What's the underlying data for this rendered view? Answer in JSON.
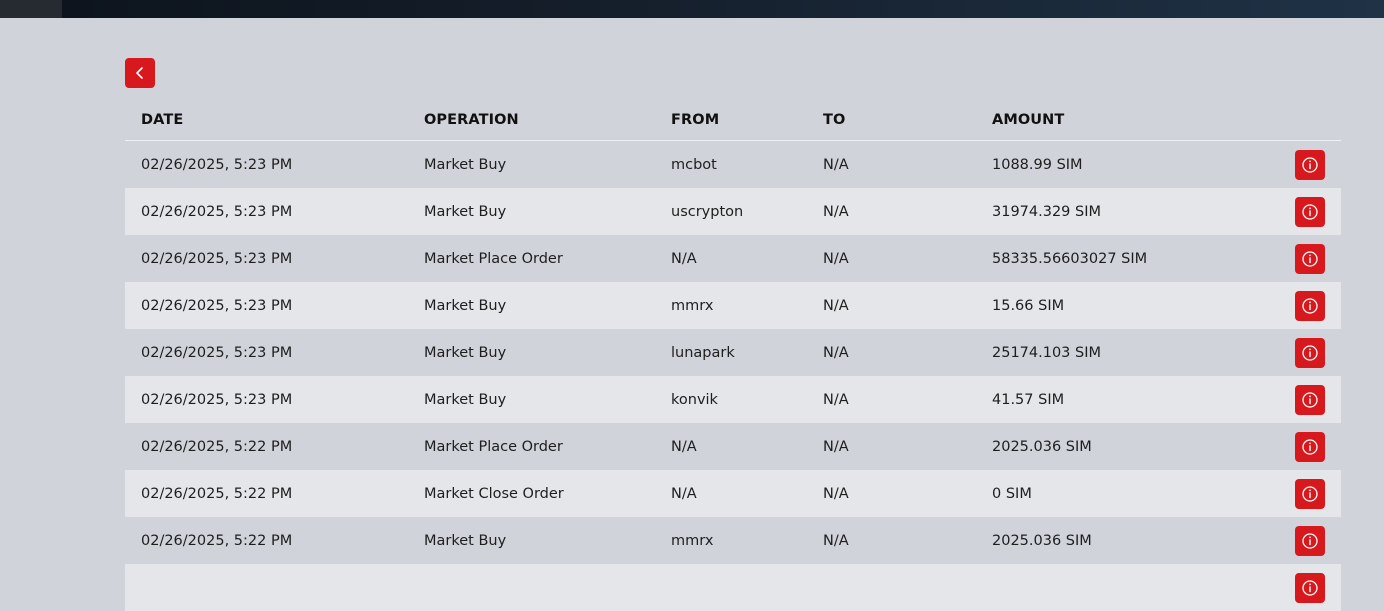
{
  "columns": {
    "date": "DATE",
    "operation": "OPERATION",
    "from": "FROM",
    "to": "TO",
    "amount": "AMOUNT"
  },
  "icons": {
    "back": "chevron-left-icon",
    "info": "info-icon"
  },
  "colors": {
    "accent": "#d7191d",
    "background": "#d0d3da",
    "row_alt": "#e5e6ea"
  },
  "rows": [
    {
      "date": "02/26/2025, 5:23 PM",
      "operation": "Market Buy",
      "from": "mcbot",
      "to": "N/A",
      "amount": "1088.99 SIM"
    },
    {
      "date": "02/26/2025, 5:23 PM",
      "operation": "Market Buy",
      "from": "uscrypton",
      "to": "N/A",
      "amount": "31974.329 SIM"
    },
    {
      "date": "02/26/2025, 5:23 PM",
      "operation": "Market Place Order",
      "from": "N/A",
      "to": "N/A",
      "amount": "58335.56603027 SIM"
    },
    {
      "date": "02/26/2025, 5:23 PM",
      "operation": "Market Buy",
      "from": "mmrx",
      "to": "N/A",
      "amount": "15.66 SIM"
    },
    {
      "date": "02/26/2025, 5:23 PM",
      "operation": "Market Buy",
      "from": "lunapark",
      "to": "N/A",
      "amount": "25174.103 SIM"
    },
    {
      "date": "02/26/2025, 5:23 PM",
      "operation": "Market Buy",
      "from": "konvik",
      "to": "N/A",
      "amount": "41.57 SIM"
    },
    {
      "date": "02/26/2025, 5:22 PM",
      "operation": "Market Place Order",
      "from": "N/A",
      "to": "N/A",
      "amount": "2025.036 SIM"
    },
    {
      "date": "02/26/2025, 5:22 PM",
      "operation": "Market Close Order",
      "from": "N/A",
      "to": "N/A",
      "amount": "0 SIM"
    },
    {
      "date": "02/26/2025, 5:22 PM",
      "operation": "Market Buy",
      "from": "mmrx",
      "to": "N/A",
      "amount": "2025.036 SIM"
    },
    {
      "date": "",
      "operation": "",
      "from": "",
      "to": "",
      "amount": ""
    }
  ]
}
